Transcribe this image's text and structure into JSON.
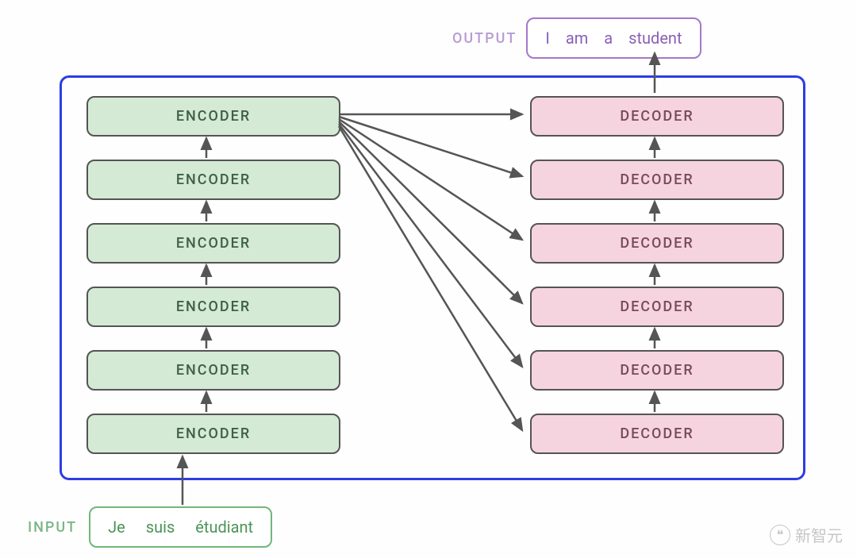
{
  "output": {
    "label": "OUTPUT",
    "tokens": [
      "I",
      "am",
      "a",
      "student"
    ]
  },
  "input": {
    "label": "INPUT",
    "tokens": [
      "Je",
      "suis",
      "étudiant"
    ]
  },
  "encoders": [
    "ENCODER",
    "ENCODER",
    "ENCODER",
    "ENCODER",
    "ENCODER",
    "ENCODER"
  ],
  "decoders": [
    "DECODER",
    "DECODER",
    "DECODER",
    "DECODER",
    "DECODER",
    "DECODER"
  ],
  "watermark": "新智元",
  "colors": {
    "encoder_fill": "#d4ead4",
    "decoder_fill": "#f5d4e0",
    "container_border": "#2d3de4",
    "input_border": "#71b77a",
    "output_border": "#a677c9",
    "arrow": "#555"
  }
}
